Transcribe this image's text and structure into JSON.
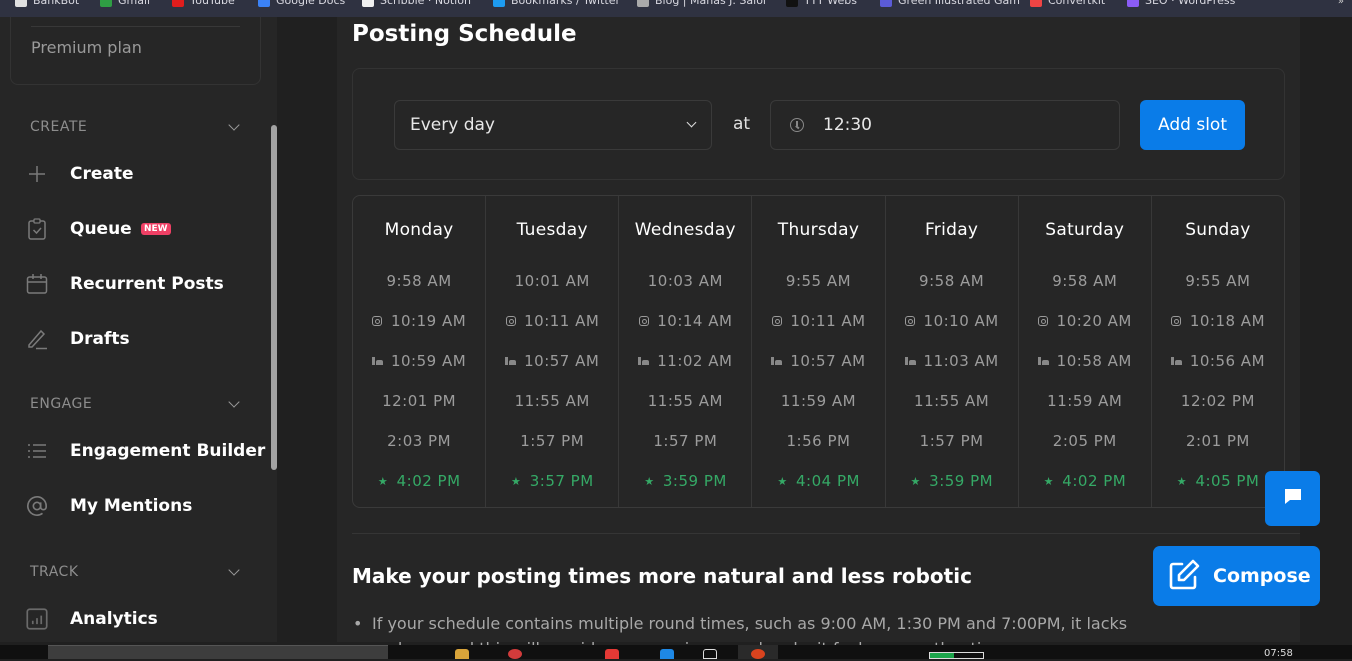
{
  "bookmarks": [
    {
      "label": "BankBot",
      "color": "#e0e0e0"
    },
    {
      "label": "Gmail",
      "color": "#2f9e44"
    },
    {
      "label": "YouTube",
      "color": "#e01d1d"
    },
    {
      "label": "Google Docs",
      "color": "#3b82f6"
    },
    {
      "label": "Scribble · Notion",
      "color": "#f0f0f0"
    },
    {
      "label": "Bookmarks / Twitter",
      "color": "#1d9bf0"
    },
    {
      "label": "Blog | Manas J. Saloi",
      "color": "#aaaaaa"
    },
    {
      "label": "TTT Webs",
      "color": "#111111"
    },
    {
      "label": "Green Illustrated Gam",
      "color": "#5b5bd6"
    },
    {
      "label": "Convertkit",
      "color": "#ef4444"
    },
    {
      "label": "SEO · WordPress",
      "color": "#8b5cf6"
    }
  ],
  "sidebar": {
    "plan_label": "Premium plan",
    "sections": [
      {
        "title": "CREATE",
        "items": [
          {
            "label": "Create",
            "icon": "plus-icon"
          },
          {
            "label": "Queue",
            "icon": "clipboard-check-icon",
            "badge": "NEW"
          },
          {
            "label": "Recurrent Posts",
            "icon": "calendar-icon"
          },
          {
            "label": "Drafts",
            "icon": "pencil-icon"
          }
        ]
      },
      {
        "title": "ENGAGE",
        "items": [
          {
            "label": "Engagement Builder",
            "icon": "list-icon"
          },
          {
            "label": "My Mentions",
            "icon": "at-sign-icon"
          }
        ]
      },
      {
        "title": "TRACK",
        "items": [
          {
            "label": "Analytics",
            "icon": "bar-chart-icon"
          }
        ]
      }
    ]
  },
  "main": {
    "title": "Posting Schedule",
    "frequency_select": {
      "value": "Every day"
    },
    "at_label": "at",
    "time_input": {
      "value": "12:30"
    },
    "add_slot_label": "Add slot",
    "days": [
      {
        "name": "Monday",
        "slots": [
          {
            "time": "9:58 AM",
            "icon": ""
          },
          {
            "time": "10:19 AM",
            "icon": "instagram"
          },
          {
            "time": "10:59 AM",
            "icon": "linkedin"
          },
          {
            "time": "12:01 PM",
            "icon": ""
          },
          {
            "time": "2:03 PM",
            "icon": ""
          },
          {
            "time": "4:02 PM",
            "icon": "star"
          }
        ]
      },
      {
        "name": "Tuesday",
        "slots": [
          {
            "time": "10:01 AM",
            "icon": ""
          },
          {
            "time": "10:11 AM",
            "icon": "instagram"
          },
          {
            "time": "10:57 AM",
            "icon": "linkedin"
          },
          {
            "time": "11:55 AM",
            "icon": ""
          },
          {
            "time": "1:57 PM",
            "icon": ""
          },
          {
            "time": "3:57 PM",
            "icon": "star"
          }
        ]
      },
      {
        "name": "Wednesday",
        "slots": [
          {
            "time": "10:03 AM",
            "icon": ""
          },
          {
            "time": "10:14 AM",
            "icon": "instagram"
          },
          {
            "time": "11:02 AM",
            "icon": "linkedin"
          },
          {
            "time": "11:55 AM",
            "icon": ""
          },
          {
            "time": "1:57 PM",
            "icon": ""
          },
          {
            "time": "3:59 PM",
            "icon": "star"
          }
        ]
      },
      {
        "name": "Thursday",
        "slots": [
          {
            "time": "9:55 AM",
            "icon": ""
          },
          {
            "time": "10:11 AM",
            "icon": "instagram"
          },
          {
            "time": "10:57 AM",
            "icon": "linkedin"
          },
          {
            "time": "11:59 AM",
            "icon": ""
          },
          {
            "time": "1:56 PM",
            "icon": ""
          },
          {
            "time": "4:04 PM",
            "icon": "star"
          }
        ]
      },
      {
        "name": "Friday",
        "slots": [
          {
            "time": "9:58 AM",
            "icon": ""
          },
          {
            "time": "10:10 AM",
            "icon": "instagram"
          },
          {
            "time": "11:03 AM",
            "icon": "linkedin"
          },
          {
            "time": "11:55 AM",
            "icon": ""
          },
          {
            "time": "1:57 PM",
            "icon": ""
          },
          {
            "time": "3:59 PM",
            "icon": "star"
          }
        ]
      },
      {
        "name": "Saturday",
        "slots": [
          {
            "time": "9:58 AM",
            "icon": ""
          },
          {
            "time": "10:20 AM",
            "icon": "instagram"
          },
          {
            "time": "10:58 AM",
            "icon": "linkedin"
          },
          {
            "time": "11:59 AM",
            "icon": ""
          },
          {
            "time": "2:05 PM",
            "icon": ""
          },
          {
            "time": "4:02 PM",
            "icon": "star"
          }
        ]
      },
      {
        "name": "Sunday",
        "slots": [
          {
            "time": "9:55 AM",
            "icon": ""
          },
          {
            "time": "10:18 AM",
            "icon": "instagram"
          },
          {
            "time": "10:56 AM",
            "icon": "linkedin"
          },
          {
            "time": "12:02 PM",
            "icon": ""
          },
          {
            "time": "2:01 PM",
            "icon": ""
          },
          {
            "time": "4:05 PM",
            "icon": "star"
          }
        ]
      }
    ],
    "tip": {
      "title": "Make your posting times more natural and less robotic",
      "text": "If your schedule contains multiple round times, such as 9:00 AM, 1:30 PM and 7:00PM, it lacks realness and this will provide some variance and make it feel more authentic."
    }
  },
  "floating": {
    "compose_label": "Compose"
  },
  "taskbar": {
    "clock": "07:58"
  },
  "colors": {
    "accent": "#0a7ce8",
    "best_time": "#35a966",
    "new_badge": "#ef4065"
  }
}
